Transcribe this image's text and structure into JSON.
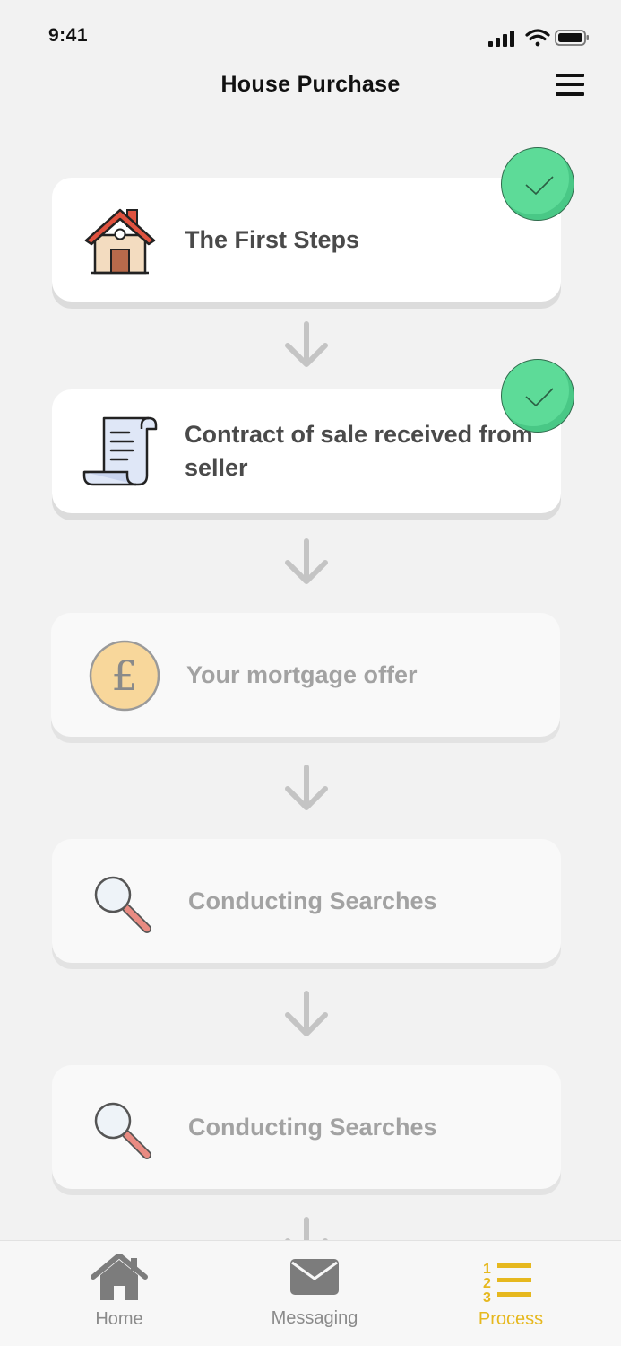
{
  "status_bar": {
    "time": "9:41"
  },
  "header": {
    "title": "House Purchase"
  },
  "steps": [
    {
      "label": "The First Steps",
      "completed": true,
      "icon": "house-icon"
    },
    {
      "label": "Contract of sale received from seller",
      "completed": true,
      "icon": "scroll-document-icon"
    },
    {
      "label": "Your mortgage offer",
      "completed": false,
      "icon": "pound-coin-icon"
    },
    {
      "label": "Conducting Searches",
      "completed": false,
      "icon": "magnifying-glass-icon"
    },
    {
      "label": "Conducting Searches",
      "completed": false,
      "icon": "magnifying-glass-icon"
    }
  ],
  "tabs": [
    {
      "label": "Home",
      "icon": "home-icon",
      "active": false
    },
    {
      "label": "Messaging",
      "icon": "envelope-icon",
      "active": false
    },
    {
      "label": "Process",
      "icon": "numbered-list-icon",
      "active": true
    }
  ],
  "colors": {
    "check": "#5ddb98",
    "accent": "#e6b81e",
    "background": "#f2f2f2"
  }
}
